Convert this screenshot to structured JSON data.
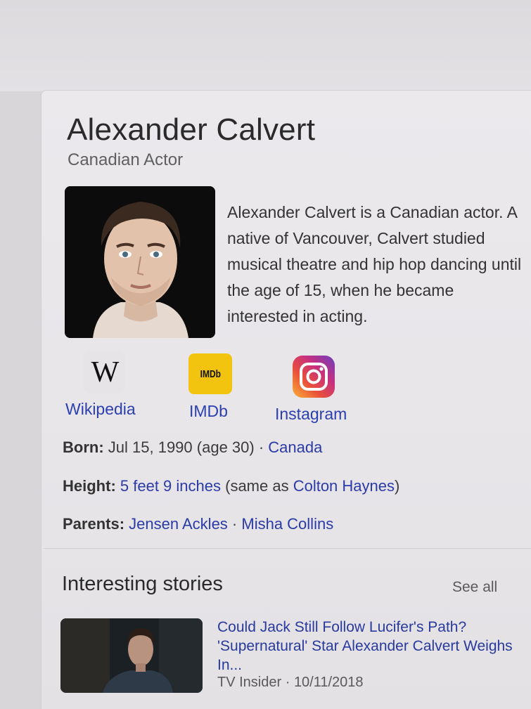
{
  "entity": {
    "name": "Alexander Calvert",
    "subtitle": "Canadian Actor",
    "description": "Alexander Calvert is a Canadian actor. A native of Vancouver, Calvert studied musical theatre and hip hop dancing until the age of 15, when he became interested in acting."
  },
  "links": [
    {
      "label": "Wikipedia",
      "icon": "wikipedia-icon",
      "glyph": "W"
    },
    {
      "label": "IMDb",
      "icon": "imdb-icon",
      "glyph": "IMDb"
    },
    {
      "label": "Instagram",
      "icon": "instagram-icon"
    }
  ],
  "facts": {
    "born": {
      "label": "Born:",
      "value": "Jul 15, 1990 (age 30)",
      "sep": " · ",
      "link": "Canada"
    },
    "height": {
      "label": "Height:",
      "value_link": "5 feet 9 inches",
      "pre": " (same as ",
      "link": "Colton Haynes",
      "post": ")"
    },
    "parents": {
      "label": "Parents:",
      "link1": "Jensen Ackles",
      "sep": " · ",
      "link2": "Misha Collins"
    }
  },
  "stories": {
    "title": "Interesting stories",
    "see_all": "See all",
    "items": [
      {
        "headline": "Could Jack Still Follow Lucifer's Path? 'Supernatural' Star Alexander Calvert Weighs In...",
        "source": "TV Insider",
        "sep": " · ",
        "date": "10/11/2018"
      }
    ]
  },
  "colors": {
    "link": "#2b3fb0",
    "imdb": "#f2c40f",
    "background": "#e9e7ea"
  }
}
